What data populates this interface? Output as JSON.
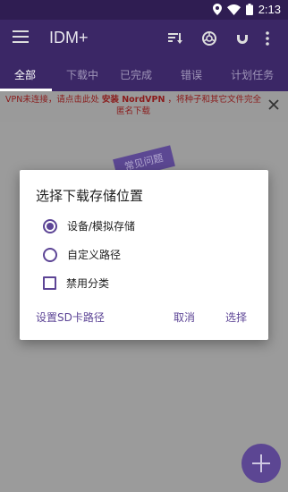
{
  "status_bar": {
    "time": "2:13"
  },
  "app_bar": {
    "title": "IDM+"
  },
  "tabs": [
    {
      "label": "全部",
      "active": true
    },
    {
      "label": "下载中",
      "active": false
    },
    {
      "label": "已完成",
      "active": false
    },
    {
      "label": "错误",
      "active": false
    },
    {
      "label": "计划任务",
      "active": false
    }
  ],
  "notice": {
    "line1_prefix": "VPN未连接，请点击此处 ",
    "line1_link": "安装 NordVPN",
    "line1_suffix": " ，将种子和其它文件完全",
    "line2": "匿名下载"
  },
  "faq_label": "常见问题",
  "dialog": {
    "title": "选择下载存储位置",
    "options": [
      {
        "label": "设备/模拟存储",
        "type": "radio",
        "selected": true
      },
      {
        "label": "自定义路径",
        "type": "radio",
        "selected": false
      },
      {
        "label": "禁用分类",
        "type": "checkbox",
        "checked": false
      }
    ],
    "sd_button": "设置SD卡路径",
    "cancel_button": "取消",
    "select_button": "选择"
  },
  "colors": {
    "accent": "#5d4596",
    "app_bar": "#3b2766",
    "notice_text": "#8a1b1b"
  }
}
